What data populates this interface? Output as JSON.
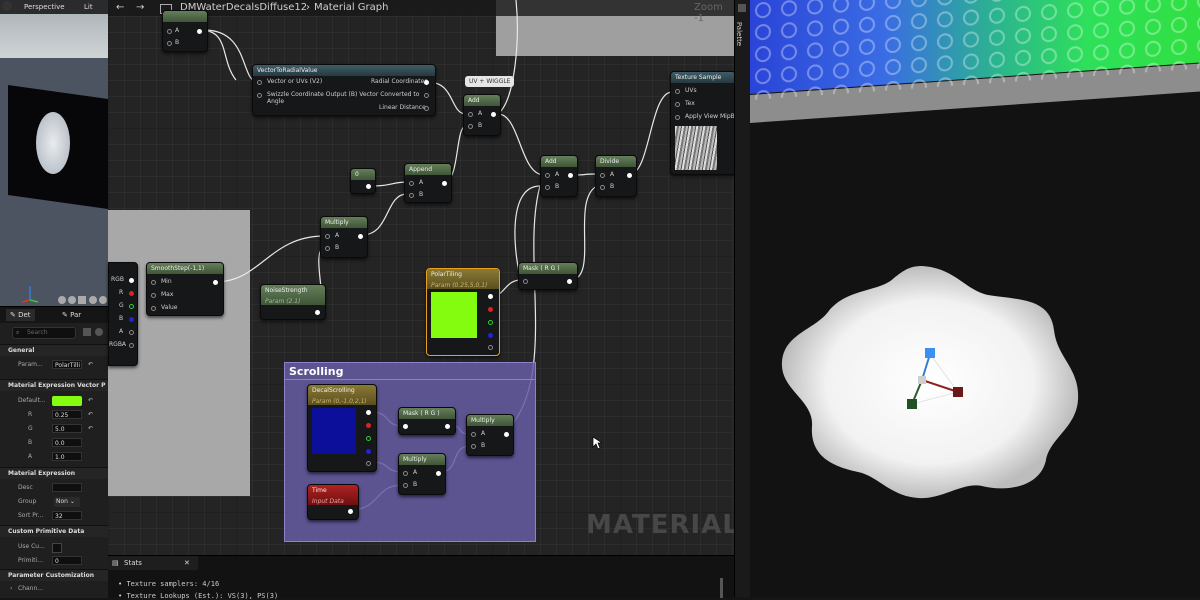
{
  "viewport_left": {
    "mode": "Perspective",
    "lit": "Lit"
  },
  "details": {
    "tab1": "Det",
    "tab2": "Par",
    "search_placeholder": "Search",
    "general": "General",
    "param_label": "Param...",
    "param_value": "PolarTilli",
    "mev_section": "Material Expression Vector P",
    "default_label": "Default...",
    "r_label": "R",
    "r_value": "0.25",
    "g_label": "G",
    "g_value": "5.0",
    "b_label": "B",
    "b_value": "0.0",
    "a_label": "A",
    "a_value": "1.0",
    "me_section": "Material Expression",
    "desc_label": "Desc",
    "group_label": "Group",
    "group_value": "Non",
    "sort_label": "Sort Pr...",
    "sort_value": "32",
    "cpd_section": "Custom Primitive Data",
    "usecu_label": "Use Cu...",
    "primiti_label": "Primiti...",
    "primiti_value": "0",
    "pc_section": "Parameter Customization",
    "chann_label": "Chann..."
  },
  "graph": {
    "asset_title": "DMWaterDecalsDiffuse12",
    "breadcrumb": "Material Graph",
    "zoom": "Zoom -1",
    "watermark": "MATERIAL",
    "palette": "Palette"
  },
  "nodes": {
    "top_a": "A",
    "top_b": "B",
    "v2r_title": "VectorToRadialValue",
    "v2r_in1": "Vector or UVs (V2)",
    "v2r_in2": "Swizzle Coordinate Output (B) Vector Converted to Angle",
    "v2r_out1": "Radial Coordinates",
    "v2r_out3": "Linear Distance",
    "comment": "UV + WIGGLE",
    "add1_title": "Add",
    "add1_a": "A",
    "add1_b": "B",
    "zero_title": "0",
    "append_title": "Append",
    "append_a": "A",
    "append_b": "B",
    "mult1_title": "Multiply",
    "mult1_a": "A",
    "mult1_b": "B",
    "smooth_title": "SmoothStep(-1,1)",
    "smooth_min": "Min",
    "smooth_max": "Max",
    "smooth_value": "Value",
    "noise_title": "NoiseStrength",
    "noise_sub": "Param (2.1)",
    "add2_title": "Add",
    "add2_a": "A",
    "add2_b": "B",
    "divide_title": "Divide",
    "divide_a": "A",
    "divide_b": "B",
    "tex_title": "Texture Sample",
    "tex_uvs": "UVs",
    "tex_tex": "Tex",
    "tex_mip": "Apply View MipBia",
    "maskrg1_title": "Mask ( R G )",
    "polar_title": "PolarTiling",
    "polar_sub": "Param (0.25,5,0,1)",
    "rgb_pins": [
      "RGB",
      "R",
      "G",
      "B",
      "A",
      "RGBA"
    ],
    "scroll_title": "Scrolling",
    "decal_title": "DecalScrolling",
    "decal_sub": "Param (0,-1,0,2,1)",
    "maskrg2_title": "Mask ( R G )",
    "mult2_title": "Multiply",
    "mult2_a": "A",
    "mult2_b": "B",
    "mult3_title": "Multiply",
    "mult3_a": "A",
    "mult3_b": "B",
    "time_title": "Time",
    "time_sub": "Input Data"
  },
  "stats": {
    "tab": "Stats",
    "line1": "Texture samplers: 4/16",
    "line2": "Texture Lookups (Est.): VS(3), PS(3)"
  },
  "colors": {
    "polar_swatch": "#84fc10",
    "decal_swatch": "#0c0f9a",
    "scrolling_bg": "#665ca4",
    "time_header": "#a01818"
  }
}
